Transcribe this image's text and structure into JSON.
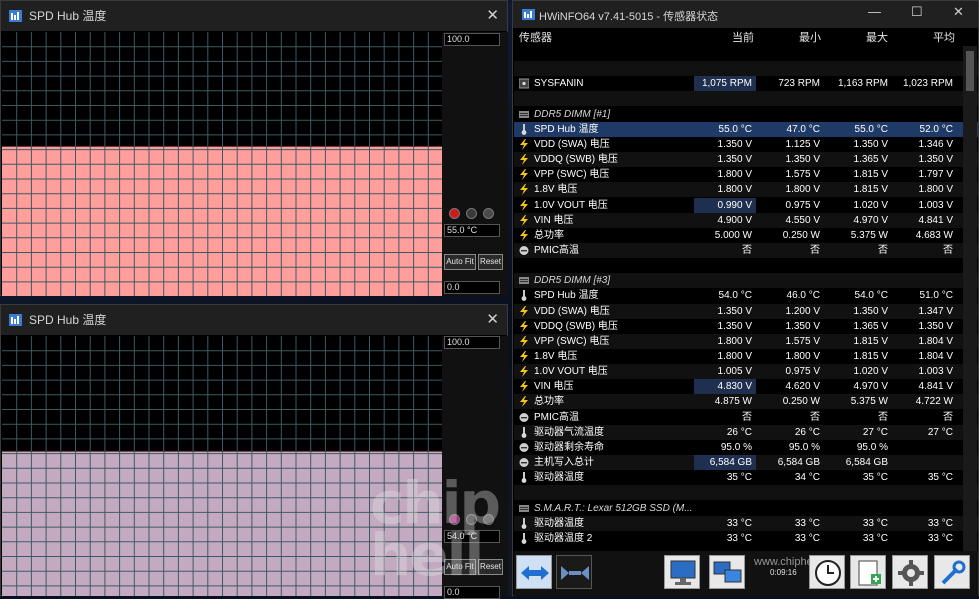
{
  "graph_windows": [
    {
      "title": "SPD Hub 温度",
      "max_label": "100.0",
      "current_label": "55.0 °C",
      "min_label": "0.0",
      "auto_fit": "Auto Fit",
      "reset": "Reset",
      "fill_color": "#ff9e9b",
      "level": 0.55,
      "active_dot_color": "#d01a1a"
    },
    {
      "title": "SPD Hub 温度",
      "max_label": "100.0",
      "current_label": "54.0 °C",
      "min_label": "0.0",
      "auto_fit": "Auto Fit",
      "reset": "Reset",
      "fill_color": "#c4aac0",
      "level": 0.54,
      "active_dot_color": "#a0307a"
    }
  ],
  "sensor_window": {
    "title": "HWiNFO64 v7.41-5015 - 传感器状态",
    "columns": [
      "传感器",
      "当前",
      "最小",
      "最大",
      "平均"
    ],
    "rows": [
      {
        "type": "blank"
      },
      {
        "type": "blank"
      },
      {
        "type": "data",
        "icon": "fan-icon",
        "name": "SYSFANIN",
        "cur": "1,075 RPM",
        "min": "723 RPM",
        "max": "1,163 RPM",
        "avg": "1,023 RPM",
        "hl": true
      },
      {
        "type": "blank"
      },
      {
        "type": "group",
        "icon": "drive-icon",
        "name": "DDR5 DIMM [#1]"
      },
      {
        "type": "data",
        "icon": "thermometer-icon",
        "name": "SPD Hub 温度",
        "cur": "55.0 °C",
        "min": "47.0 °C",
        "max": "55.0 °C",
        "avg": "52.0 °C",
        "sel": true
      },
      {
        "type": "data",
        "icon": "voltage-icon",
        "name": "VDD (SWA) 电压",
        "cur": "1.350 V",
        "min": "1.125 V",
        "max": "1.350 V",
        "avg": "1.346 V"
      },
      {
        "type": "data",
        "icon": "voltage-icon",
        "name": "VDDQ (SWB) 电压",
        "cur": "1.350 V",
        "min": "1.350 V",
        "max": "1.365 V",
        "avg": "1.350 V"
      },
      {
        "type": "data",
        "icon": "voltage-icon",
        "name": "VPP (SWC) 电压",
        "cur": "1.800 V",
        "min": "1.575 V",
        "max": "1.815 V",
        "avg": "1.797 V"
      },
      {
        "type": "data",
        "icon": "voltage-icon",
        "name": "1.8V 电压",
        "cur": "1.800 V",
        "min": "1.800 V",
        "max": "1.815 V",
        "avg": "1.800 V"
      },
      {
        "type": "data",
        "icon": "voltage-icon",
        "name": "1.0V VOUT 电压",
        "cur": "0.990 V",
        "min": "0.975 V",
        "max": "1.020 V",
        "avg": "1.003 V",
        "hl": true
      },
      {
        "type": "data",
        "icon": "voltage-icon",
        "name": "VIN 电压",
        "cur": "4.900 V",
        "min": "4.550 V",
        "max": "4.970 V",
        "avg": "4.841 V"
      },
      {
        "type": "data",
        "icon": "voltage-icon",
        "name": "总功率",
        "cur": "5.000 W",
        "min": "0.250 W",
        "max": "5.375 W",
        "avg": "4.683 W"
      },
      {
        "type": "data",
        "icon": "status-icon",
        "name": "PMIC高温",
        "cur": "否",
        "min": "否",
        "max": "否",
        "avg": "否"
      },
      {
        "type": "blank"
      },
      {
        "type": "group",
        "icon": "drive-icon",
        "name": "DDR5 DIMM [#3]"
      },
      {
        "type": "data",
        "icon": "thermometer-icon",
        "name": "SPD Hub 温度",
        "cur": "54.0 °C",
        "min": "46.0 °C",
        "max": "54.0 °C",
        "avg": "51.0 °C"
      },
      {
        "type": "data",
        "icon": "voltage-icon",
        "name": "VDD (SWA) 电压",
        "cur": "1.350 V",
        "min": "1.200 V",
        "max": "1.350 V",
        "avg": "1.347 V"
      },
      {
        "type": "data",
        "icon": "voltage-icon",
        "name": "VDDQ (SWB) 电压",
        "cur": "1.350 V",
        "min": "1.350 V",
        "max": "1.365 V",
        "avg": "1.350 V"
      },
      {
        "type": "data",
        "icon": "voltage-icon",
        "name": "VPP (SWC) 电压",
        "cur": "1.800 V",
        "min": "1.575 V",
        "max": "1.815 V",
        "avg": "1.804 V"
      },
      {
        "type": "data",
        "icon": "voltage-icon",
        "name": "1.8V 电压",
        "cur": "1.800 V",
        "min": "1.800 V",
        "max": "1.815 V",
        "avg": "1.804 V"
      },
      {
        "type": "data",
        "icon": "voltage-icon",
        "name": "1.0V VOUT 电压",
        "cur": "1.005 V",
        "min": "0.975 V",
        "max": "1.020 V",
        "avg": "1.003 V"
      },
      {
        "type": "data",
        "icon": "voltage-icon",
        "name": "VIN 电压",
        "cur": "4.830 V",
        "min": "4.620 V",
        "max": "4.970 V",
        "avg": "4.841 V",
        "hl": true
      },
      {
        "type": "data",
        "icon": "voltage-icon",
        "name": "总功率",
        "cur": "4.875 W",
        "min": "0.250 W",
        "max": "5.375 W",
        "avg": "4.722 W"
      },
      {
        "type": "data",
        "icon": "status-icon",
        "name": "PMIC高温",
        "cur": "否",
        "min": "否",
        "max": "否",
        "avg": "否"
      },
      {
        "type": "data",
        "icon": "thermometer-icon",
        "name": "驱动器气流温度",
        "cur": "26 °C",
        "min": "26 °C",
        "max": "27 °C",
        "avg": "27 °C"
      },
      {
        "type": "data",
        "icon": "status-icon",
        "name": "驱动器剩余寿命",
        "cur": "95.0 %",
        "min": "95.0 %",
        "max": "95.0 %",
        "avg": ""
      },
      {
        "type": "data",
        "icon": "status-icon",
        "name": "主机写入总计",
        "cur": "6,584 GB",
        "min": "6,584 GB",
        "max": "6,584 GB",
        "avg": "",
        "hl": true
      },
      {
        "type": "data",
        "icon": "thermometer-icon",
        "name": "驱动器温度",
        "cur": "35 °C",
        "min": "34 °C",
        "max": "35 °C",
        "avg": "35 °C"
      },
      {
        "type": "blank"
      },
      {
        "type": "group",
        "icon": "drive-icon",
        "name": "S.M.A.R.T.: Lexar 512GB SSD (M..."
      },
      {
        "type": "data",
        "icon": "thermometer-icon",
        "name": "驱动器温度",
        "cur": "33 °C",
        "min": "33 °C",
        "max": "33 °C",
        "avg": "33 °C"
      },
      {
        "type": "data",
        "icon": "thermometer-icon",
        "name": "驱动器温度 2",
        "cur": "33 °C",
        "min": "33 °C",
        "max": "33 °C",
        "avg": "33 °C"
      }
    ],
    "toolbar": {
      "elapsed": "0:09:16",
      "watermark": "www.chiphell.com"
    }
  },
  "watermark_logo": "chip hell"
}
